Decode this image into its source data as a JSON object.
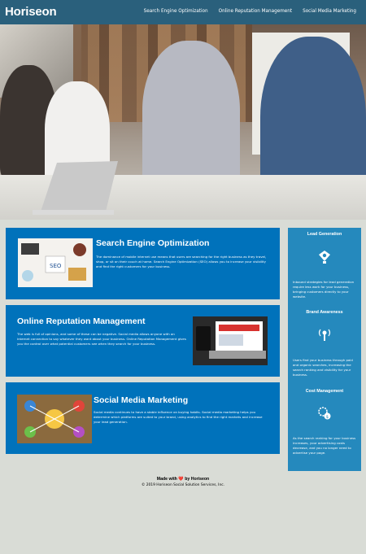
{
  "header": {
    "logo": "Horiseon",
    "nav": [
      {
        "label": "Search Engine Optimization"
      },
      {
        "label": "Online Reputation Management"
      },
      {
        "label": "Social Media Marketing"
      }
    ]
  },
  "articles": [
    {
      "title": "Search Engine Optimization",
      "text": "The dominance of mobile internet use means that users are searching for the right business as they travel, shop, or sit on their couch at home. Search Engine Optimization (SEO) allows you to increase your visibility and find the right customers for your business."
    },
    {
      "title": "Online Reputation Management",
      "text": "The web is full of opinions, and some of these can be negative. Social media allows anyone with an internet connection to say whatever they want about your business. Online Reputation Management gives you the control over what potential customers see when they search for your business."
    },
    {
      "title": "Social Media Marketing",
      "text": "Social media continues to have a stable influence on buying habits. Social media marketing helps you determine which platforms are suited to your brand, using analytics to find the right markets and increase your lead generation."
    }
  ],
  "sidebar": [
    {
      "title": "Lead Generation",
      "icon": "lightbulb-icon",
      "text": "Inbound strategies for lead generation require less work for your business, bringing customers directly to your website."
    },
    {
      "title": "Brand Awareness",
      "icon": "broadcast-icon",
      "text": "Users find your business through paid and organic searches, increasing the search ranking and visibility for your business."
    },
    {
      "title": "Cost Management",
      "icon": "gears-dollar-icon",
      "text": "As the search ranking for your business increases, your advertising costs decrease, and you no longer need to advertise your page."
    }
  ],
  "footer": {
    "made_prefix": "Made with",
    "heart": "❤️",
    "made_suffix": "by Horiseon",
    "copyright": "© 2019 Horiseon Social Solution Services, Inc."
  },
  "colors": {
    "header_bg": "#2a607c",
    "article_bg": "#0072bb",
    "sidebar_bg": "#2589bd",
    "page_bg": "#d9dcd6"
  }
}
